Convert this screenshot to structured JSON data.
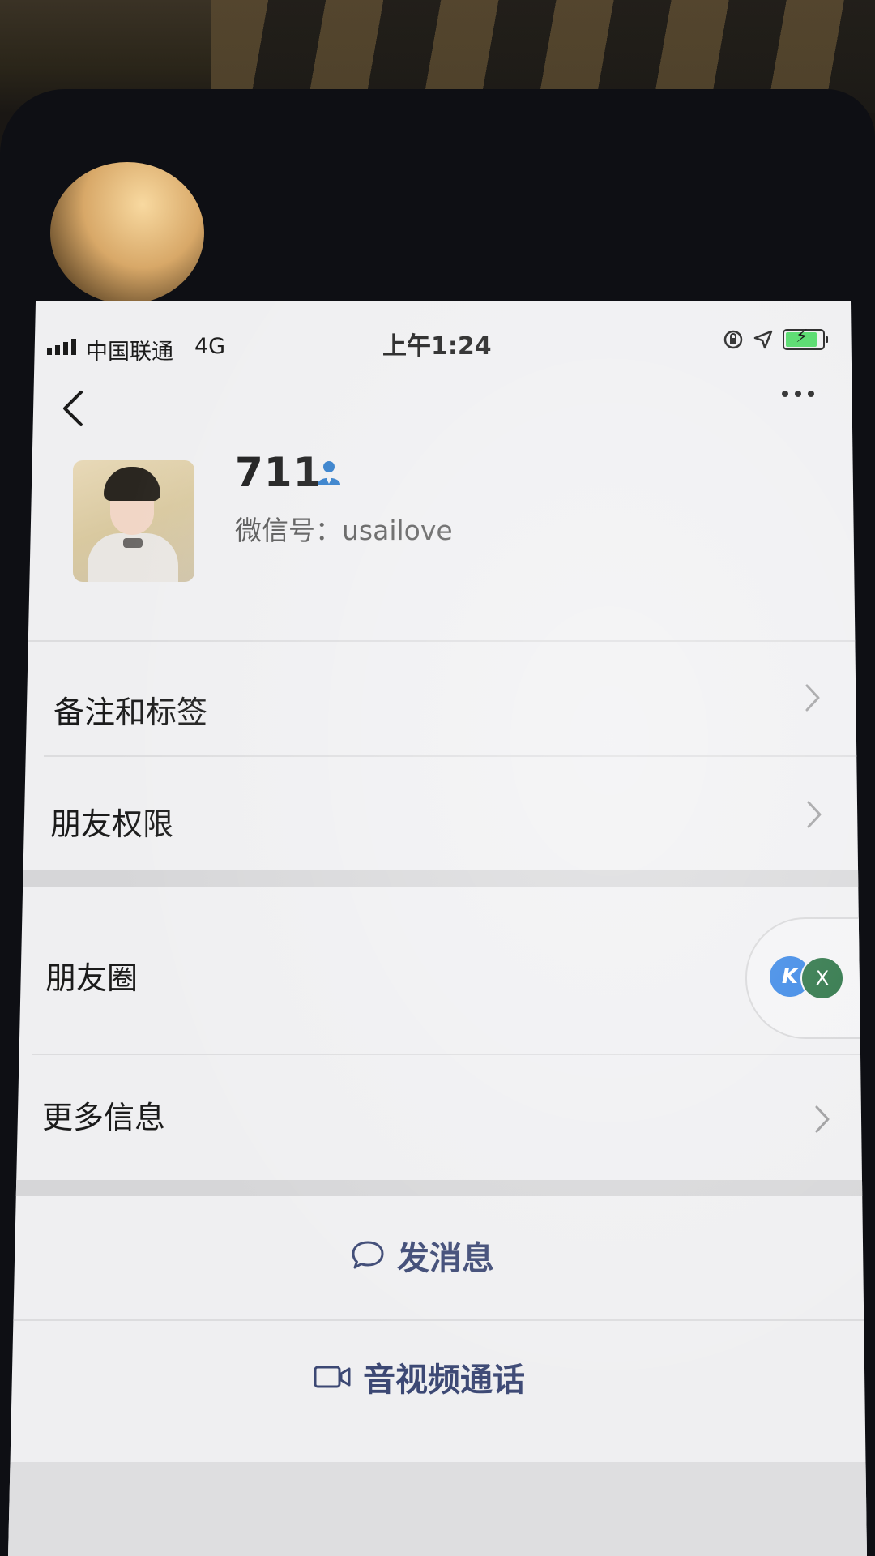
{
  "status_bar": {
    "carrier": "中国联通",
    "network": "4G",
    "time": "上午1:24"
  },
  "nav": {
    "back_icon": "chevron-left-icon",
    "more_icon": "more-dots-icon"
  },
  "profile": {
    "name": "711",
    "wechat_id": "微信号：usailove",
    "verified_icon": "person-icon"
  },
  "menu": {
    "items": [
      {
        "label": "备注和标签"
      },
      {
        "label": "朋友权限"
      },
      {
        "label": "朋友圈"
      },
      {
        "label": "更多信息"
      }
    ]
  },
  "floating_widget": {
    "badge_2": "X"
  },
  "actions": {
    "message": "发消息",
    "call": "音视频通话"
  },
  "colors": {
    "screen_bg": "#efeff1",
    "action_text": "#3c4874",
    "battery": "#4cd964"
  }
}
